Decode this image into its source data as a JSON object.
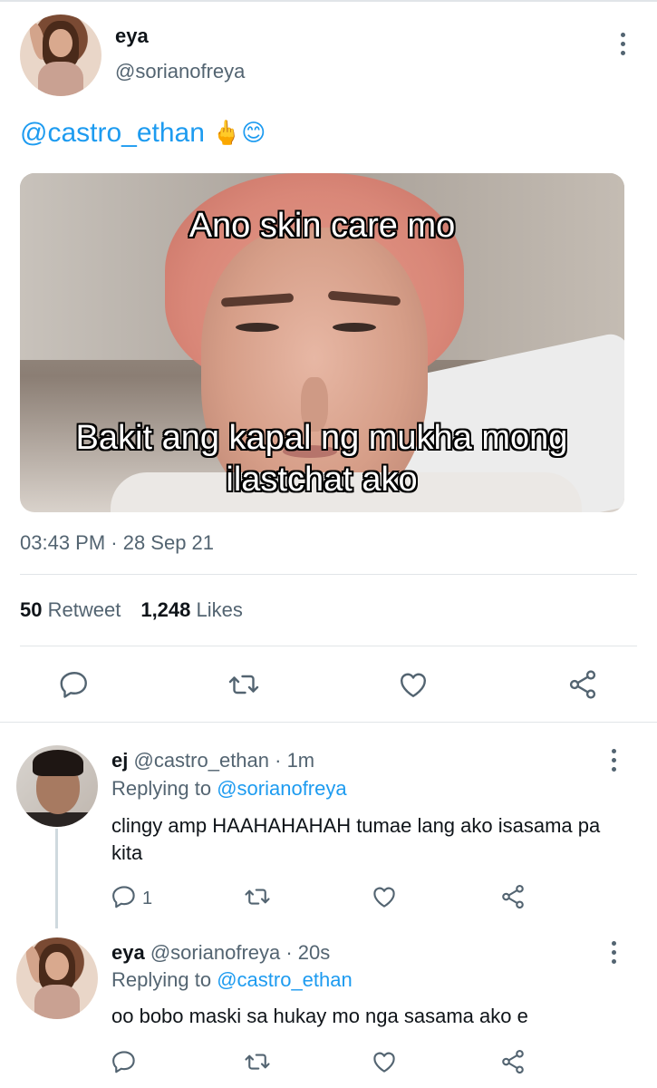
{
  "tweet": {
    "name": "eya",
    "handle": "@sorianofreya",
    "text": "@castro_ethan",
    "emojis": "🖕😊",
    "meme_top": "Ano skin care mo",
    "meme_bottom": "Bakit ang kapal ng mukha mong ilastchat ako",
    "timestamp": "03:43 PM · 28 Sep 21",
    "retweet_count": "50",
    "retweet_label": "Retweet",
    "likes_count": "1,248",
    "likes_label": "Likes"
  },
  "icons": [
    "reply-icon",
    "retweet-icon",
    "like-icon",
    "share-icon",
    "more-icon"
  ],
  "replies": [
    {
      "name": "ej",
      "meta": "@castro_ethan · 1m",
      "replying_prefix": "Replying to",
      "replying_to": "@sorianofreya",
      "text": "clingy amp HAAHAHAHAH tumae lang ako isasama pa kita",
      "reply_count": "1"
    },
    {
      "name": "eya",
      "meta": "@sorianofreya · 20s",
      "replying_prefix": "Replying to",
      "replying_to": "@castro_ethan",
      "text": "oo bobo maski sa hukay mo nga sasama ako e",
      "reply_count": ""
    }
  ],
  "colors": {
    "link": "#1d9bf0",
    "secondary": "#536471",
    "divider": "#e1e5e8"
  }
}
